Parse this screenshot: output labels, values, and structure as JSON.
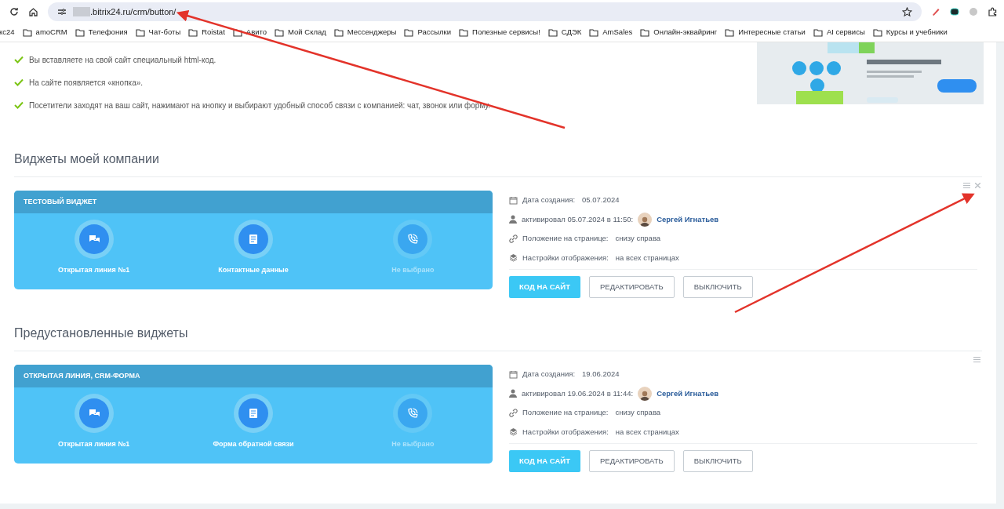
{
  "browser": {
    "url_host": ".bitrix24.ru/crm/button/",
    "bookmarks": [
      {
        "label": "кс24",
        "folder": false
      },
      {
        "label": "amoCRM",
        "folder": true
      },
      {
        "label": "Телефония",
        "folder": true
      },
      {
        "label": "Чат-боты",
        "folder": true
      },
      {
        "label": "Roistat",
        "folder": true
      },
      {
        "label": "Авито",
        "folder": true
      },
      {
        "label": "Мой Склад",
        "folder": true
      },
      {
        "label": "Мессенджеры",
        "folder": true
      },
      {
        "label": "Рассылки",
        "folder": true
      },
      {
        "label": "Полезные сервисы!",
        "folder": true
      },
      {
        "label": "СДЭК",
        "folder": true
      },
      {
        "label": "AmSales",
        "folder": true
      },
      {
        "label": "Онлайн-эквайринг",
        "folder": true
      },
      {
        "label": "Интересные статьи",
        "folder": true
      },
      {
        "label": "AI сервисы",
        "folder": true
      },
      {
        "label": "Курсы и учебники",
        "folder": true
      }
    ]
  },
  "intro_points": [
    "Вы вставляете на свой сайт специальный html-код.",
    "На сайте появляется «кнопка».",
    "Посетители заходят на ваш сайт, нажимают на кнопку и выбирают удобный способ связи с компанией: чат, звонок или форму."
  ],
  "sections": [
    {
      "title": "Виджеты моей компании",
      "widgets": [
        {
          "name": "ТЕСТОВЫЙ ВИДЖЕТ",
          "closable": true,
          "channels": [
            {
              "kind": "chat",
              "label": "Открытая линия №1",
              "selected": true
            },
            {
              "kind": "form",
              "label": "Контактные данные",
              "selected": true
            },
            {
              "kind": "phone",
              "label": "Не выбрано",
              "selected": false
            }
          ],
          "created_label": "Дата создания:",
          "created_date": "05.07.2024",
          "activated": "активировал 05.07.2024 в 11:50:",
          "user": "Сергей Игнатьев",
          "position_label": "Положение на странице:",
          "position_value": "снизу справа",
          "display_label": "Настройки отображения:",
          "display_value": "на всех страницах",
          "buttons": [
            {
              "kind": "primary",
              "label": "КОД НА САЙТ"
            },
            {
              "kind": "outline",
              "label": "РЕДАКТИРОВАТЬ"
            },
            {
              "kind": "outline",
              "label": "ВЫКЛЮЧИТЬ"
            }
          ]
        }
      ]
    },
    {
      "title": "Предустановленные виджеты",
      "widgets": [
        {
          "name": "ОТКРЫТАЯ ЛИНИЯ, CRM-ФОРМА",
          "closable": false,
          "channels": [
            {
              "kind": "chat",
              "label": "Открытая линия №1",
              "selected": true
            },
            {
              "kind": "form",
              "label": "Форма обратной связи",
              "selected": true
            },
            {
              "kind": "phone",
              "label": "Не выбрано",
              "selected": false
            }
          ],
          "created_label": "Дата создания:",
          "created_date": "19.06.2024",
          "activated": "активировал 19.06.2024 в 11:44:",
          "user": "Сергей Игнатьев",
          "position_label": "Положение на странице:",
          "position_value": "снизу справа",
          "display_label": "Настройки отображения:",
          "display_value": "на всех страницах",
          "buttons": [
            {
              "kind": "primary",
              "label": "КОД НА САЙТ"
            },
            {
              "kind": "outline",
              "label": "РЕДАКТИРОВАТЬ"
            },
            {
              "kind": "outline",
              "label": "ВЫКЛЮЧИТЬ"
            }
          ]
        }
      ]
    }
  ]
}
